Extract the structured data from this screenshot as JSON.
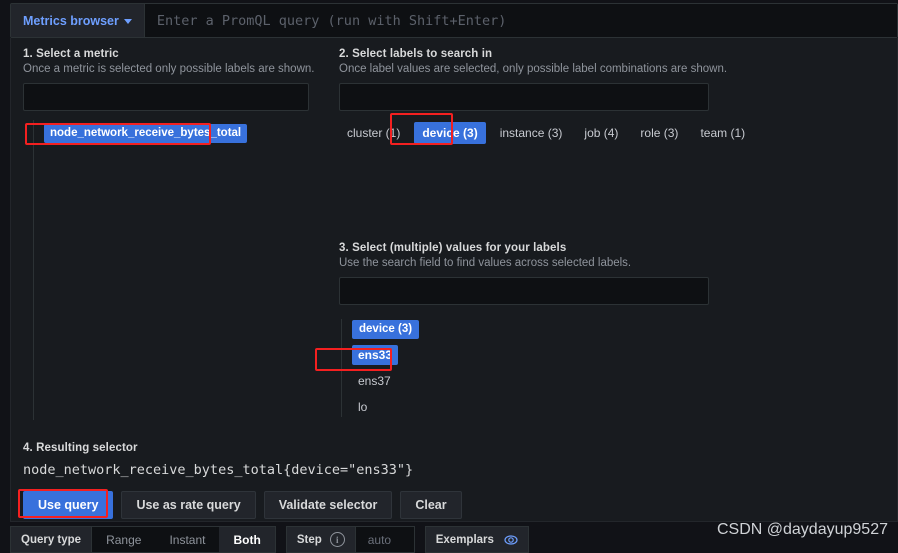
{
  "query_bar": {
    "metrics_browser_label": "Metrics browser",
    "chevron_icon": "chevron-down-icon",
    "promql_placeholder": "Enter a PromQL query (run with Shift+Enter)",
    "promql_value": ""
  },
  "step1": {
    "title": "1. Select a metric",
    "subtitle": "Once a metric is selected only possible labels are shown.",
    "search_value": "",
    "metrics": [
      "node_network_receive_bytes_total"
    ],
    "selected_metric": "node_network_receive_bytes_total"
  },
  "step2": {
    "title": "2. Select labels to search in",
    "subtitle": "Once label values are selected, only possible label combinations are shown.",
    "search_value": "",
    "labels": [
      {
        "label": "cluster (1)",
        "selected": false
      },
      {
        "label": "device (3)",
        "selected": true
      },
      {
        "label": "instance (3)",
        "selected": false
      },
      {
        "label": "job (4)",
        "selected": false
      },
      {
        "label": "role (3)",
        "selected": false
      },
      {
        "label": "team (1)",
        "selected": false
      }
    ]
  },
  "step3": {
    "title": "3. Select (multiple) values for your labels",
    "subtitle": "Use the search field to find values across selected labels.",
    "search_value": "",
    "columns": [
      {
        "header": "device (3)",
        "values": [
          {
            "label": "ens33",
            "selected": true
          },
          {
            "label": "ens37",
            "selected": false
          },
          {
            "label": "lo",
            "selected": false
          }
        ]
      }
    ]
  },
  "step4": {
    "title": "4. Resulting selector",
    "selector": "node_network_receive_bytes_total{device=\"ens33\"}",
    "buttons": [
      {
        "label": "Use query",
        "primary": true
      },
      {
        "label": "Use as rate query",
        "primary": false
      },
      {
        "label": "Validate selector",
        "primary": false
      },
      {
        "label": "Clear",
        "primary": false
      }
    ]
  },
  "options_bar": {
    "query_type_label": "Query type",
    "query_type_options": [
      {
        "label": "Range",
        "active": false
      },
      {
        "label": "Instant",
        "active": false
      },
      {
        "label": "Both",
        "active": true
      }
    ],
    "step_label": "Step",
    "step_info_icon": "info-circle-icon",
    "step_placeholder": "auto",
    "step_value": "",
    "exemplars_label": "Exemplars",
    "exemplars_icon": "eye-target-icon"
  },
  "watermark": "CSDN @daydayup9527",
  "colors": {
    "accent": "#3871dc",
    "annotation": "#f42020",
    "panel_bg": "#181b1f",
    "input_bg": "#0e1013",
    "text": "#d8d9da",
    "muted_text": "#8f949c"
  }
}
